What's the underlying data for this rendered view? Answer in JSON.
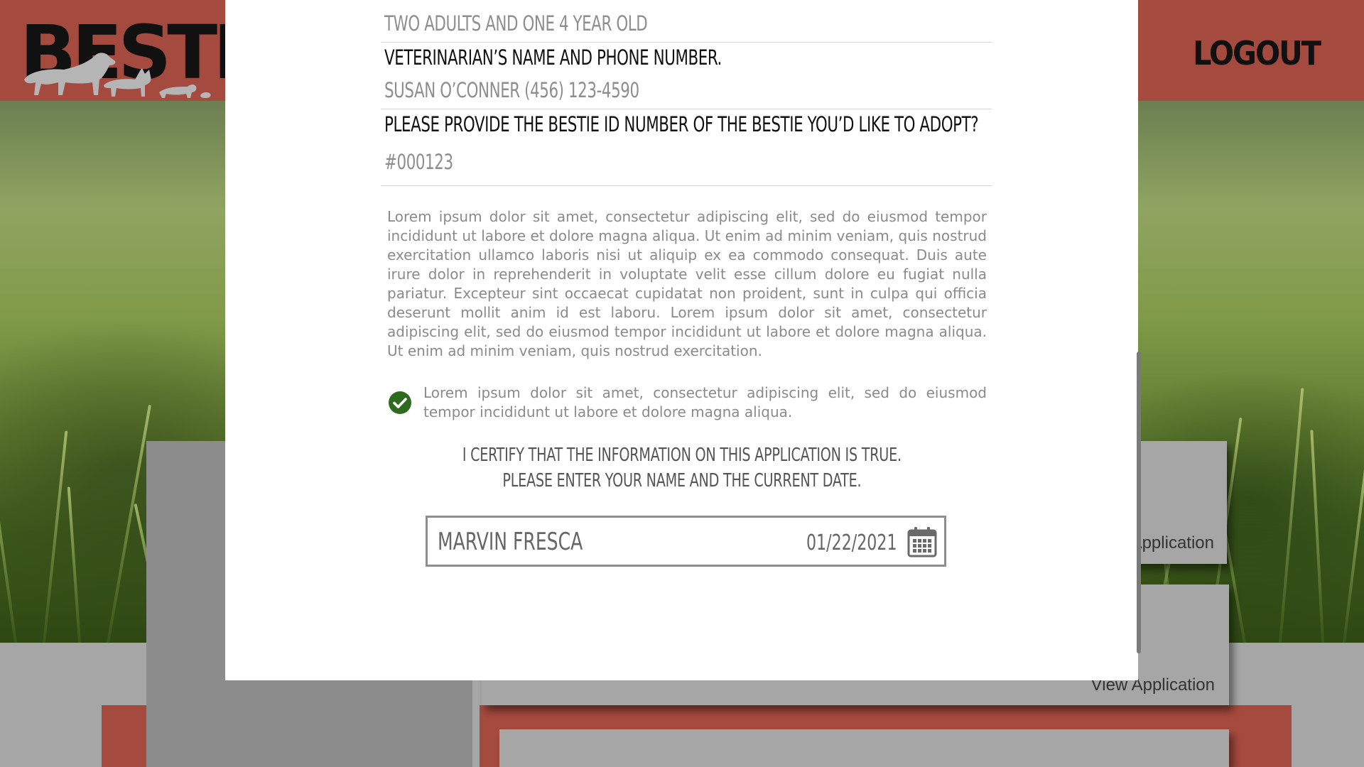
{
  "header": {
    "logo_text": "BESTIE",
    "logout_label": "LOGOUT"
  },
  "background": {
    "card_1_link": "Application",
    "card_2_link": "View Application"
  },
  "form": {
    "household_value": "TWO ADULTS AND ONE 4 YEAR OLD",
    "vet_label": "VETERINARIAN’S NAME AND PHONE NUMBER.",
    "vet_value": "SUSAN O’CONNER (456) 123-4590",
    "bestie_id_label": "PLEASE PROVIDE THE BESTIE ID NUMBER OF THE BESTIE YOU’D LIKE TO ADOPT?",
    "bestie_id_value": "#000123",
    "terms_paragraph": "Lorem ipsum dolor sit amet, consectetur adipiscing elit, sed do eiusmod tempor incididunt ut labore et dolore magna aliqua. Ut enim ad minim veniam, quis nostrud exercitation ullamco laboris nisi ut aliquip ex ea commodo consequat. Duis aute irure dolor in reprehenderit in voluptate velit esse cillum dolore eu fugiat nulla pariatur. Excepteur sint occaecat cupidatat non proident, sunt in culpa qui officia deserunt mollit anim id est laboru. Lorem ipsum dolor sit amet, consectetur adipiscing elit, sed do eiusmod tempor incididunt ut labore et dolore magna aliqua. Ut enim ad minim veniam, quis nostrud exercitation.",
    "agree_checked": true,
    "agree_text": "Lorem ipsum dolor sit amet, consectetur adipiscing elit, sed do eiusmod tempor incididunt ut labore et dolore magna aliqua.",
    "certify_line_1": "I CERTIFY THAT THE INFORMATION ON THIS APPLICATION IS TRUE.",
    "certify_line_2": "PLEASE ENTER YOUR NAME AND THE CURRENT DATE.",
    "signature_name": "MARVIN FRESCA",
    "signature_date": "01/22/2021"
  },
  "colors": {
    "brand_red": "#a54a3e",
    "check_green": "#2f6b1f",
    "label_dark": "#111111",
    "value_gray": "#8e8e8e"
  },
  "icons": [
    "paw-animals-icon",
    "check-circle-icon",
    "calendar-icon"
  ]
}
